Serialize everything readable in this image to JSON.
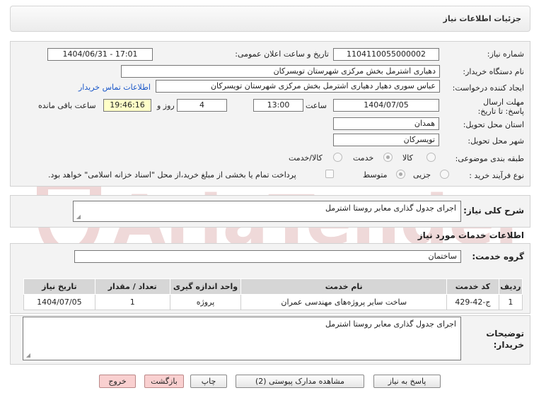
{
  "header": {
    "title": "جزئیات اطلاعات نیاز"
  },
  "fields": {
    "need_number_label": "شماره نیاز:",
    "need_number": "1104110055000002",
    "announce_label": "تاریخ و ساعت اعلان عمومی:",
    "announce_value": "1404/06/31 - 17:01",
    "buyer_label": "نام دستگاه خریدار:",
    "buyer_value": "دهیاری اشترمل بخش مرکزی شهرستان تویسرکان",
    "requester_label": "ایجاد کننده درخواست:",
    "requester_value": "عباس سوری دهیار دهیاری اشترمل بخش مرکزی شهرستان تویسرکان",
    "contact_link": "اطلاعات تماس خریدار",
    "deadline_label": "مهلت ارسال پاسخ: تا تاریخ:",
    "deadline_date": "1404/07/05",
    "time_label": "ساعت",
    "deadline_time": "13:00",
    "days_value": "4",
    "days_label": "روز و",
    "remaining_time": "19:46:16",
    "remaining_label": "ساعت باقی مانده",
    "province_label": "استان محل تحویل:",
    "province_value": "همدان",
    "city_label": "شهر محل تحویل:",
    "city_value": "تویسرکان",
    "category_label": "طبقه بندی موضوعی:",
    "cat_goods": "کالا",
    "cat_service": "خدمت",
    "cat_goods_service": "کالا/خدمت",
    "process_label": "نوع فرآیند خرید :",
    "proc_partial": "جزیی",
    "proc_medium": "متوسط",
    "payment_note": "پرداخت تمام یا بخشی از مبلغ خرید،از محل \"اسناد خزانه اسلامی\" خواهد بود."
  },
  "summary": {
    "label": "شرح کلی نیاز:",
    "value": "اجرای جدول گذاری معابر روستا اشترمل"
  },
  "services": {
    "section_title": "اطلاعات خدمات مورد نیاز",
    "group_label": "گروه خدمت:",
    "group_value": "ساختمان"
  },
  "table": {
    "headers": [
      "ردیف",
      "کد خدمت",
      "نام خدمت",
      "واحد اندازه گیری",
      "تعداد / مقدار",
      "تاریخ نیاز"
    ],
    "rows": [
      [
        "1",
        "ج-42-429",
        "ساخت سایر پروژه‌های مهندسی عمران",
        "پروژه",
        "1",
        "1404/07/05"
      ]
    ]
  },
  "buyer_notes": {
    "label": "توضیحات خریدار:",
    "value": "اجرای جدول گذاری معابر روستا اشترمل"
  },
  "buttons": {
    "reply": "پاسخ به نیاز",
    "docs": "مشاهده مدارک پیوستی (2)",
    "print": "چاپ",
    "back": "بازگشت",
    "exit": "خروج"
  },
  "watermark": {
    "text": "AriaTender.net"
  },
  "colors": {
    "link": "#1a57c8",
    "remaining_bg": "#ffffc8",
    "pink_button": "#f9d0d0",
    "watermark": "#e8caca"
  }
}
